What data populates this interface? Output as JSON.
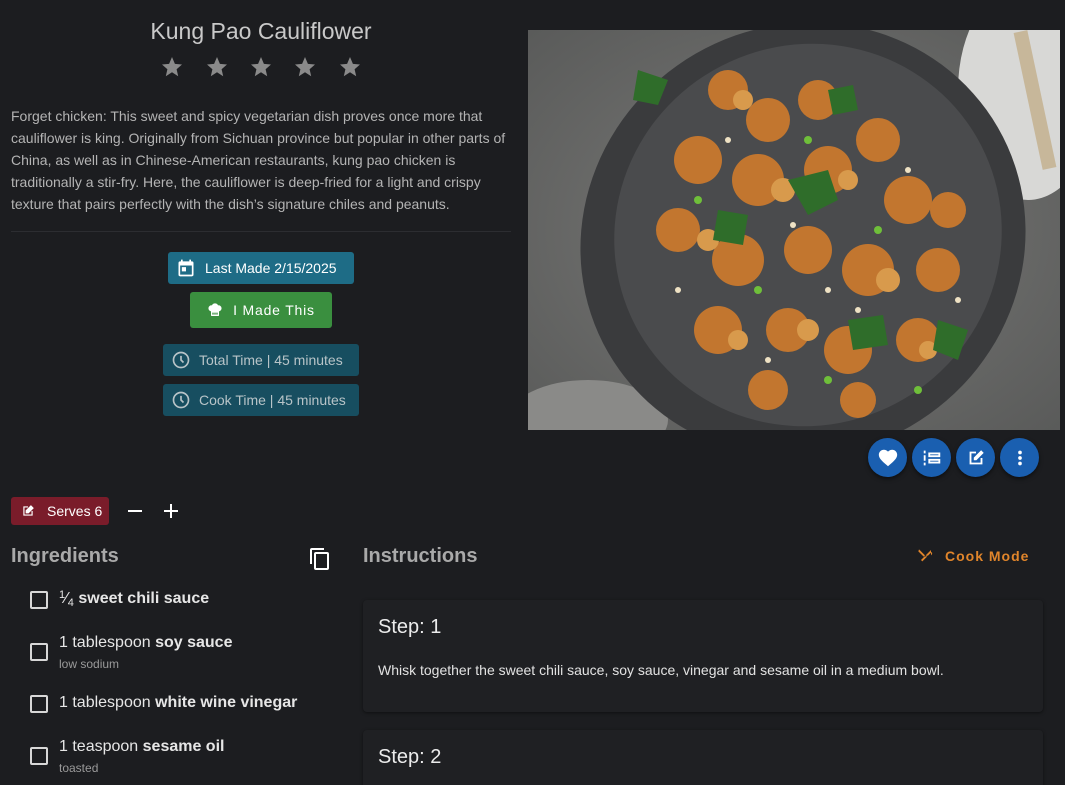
{
  "recipe": {
    "title": "Kung Pao Cauliflower",
    "rating_stars": 5,
    "description": "Forget chicken: This sweet and spicy vegetarian dish proves once more that cauliflower is king. Originally from Sichuan province but popular in other parts of China, as well as in Chinese-American restaurants, kung pao chicken is traditionally a stir-fry. Here, the cauliflower is deep-fried for a light and crispy texture that pairs perfectly with the dish’s signature chiles and peanuts.",
    "last_made_label": "Last Made 2/15/2025",
    "made_this_label": "I Made This",
    "total_time_label": "Total Time | 45 minutes",
    "cook_time_label": "Cook Time | 45 minutes",
    "serves_label": "Serves 6"
  },
  "sections": {
    "ingredients_title": "Ingredients",
    "instructions_title": "Instructions",
    "cook_mode_label": "Cook Mode"
  },
  "ingredients": [
    {
      "qty_num": "1",
      "qty_den": "4",
      "qty": "",
      "name": "sweet chili sauce",
      "note": ""
    },
    {
      "qty": "1 tablespoon",
      "name": "soy sauce",
      "note": "low sodium"
    },
    {
      "qty": "1 tablespoon",
      "name": "white wine vinegar",
      "note": ""
    },
    {
      "qty": "1 teaspoon",
      "name": "sesame oil",
      "note": "toasted"
    }
  ],
  "steps": [
    {
      "title": "Step: 1",
      "text": "Whisk together the sweet chili sauce, soy sauce, vinegar and sesame oil in a medium bowl."
    },
    {
      "title": "Step: 2",
      "text": ""
    }
  ],
  "colors": {
    "background": "#1c1d20",
    "last_made_chip": "#1e6c86",
    "made_this_button": "#3a8f3f",
    "time_chip": "#174e60",
    "fab": "#1a5fb0",
    "serves_chip": "#7a1c2a",
    "cook_mode_accent": "#e0852b"
  },
  "icons": {
    "calendar": "calendar-icon",
    "chef_hat": "chef-hat-icon",
    "clock": "clock-icon",
    "heart": "heart-icon",
    "timeline": "timeline-icon",
    "edit": "edit-icon",
    "more": "more-vert-icon",
    "copy": "copy-icon",
    "utensils": "utensils-icon",
    "minus": "minus-icon",
    "plus": "plus-icon"
  }
}
